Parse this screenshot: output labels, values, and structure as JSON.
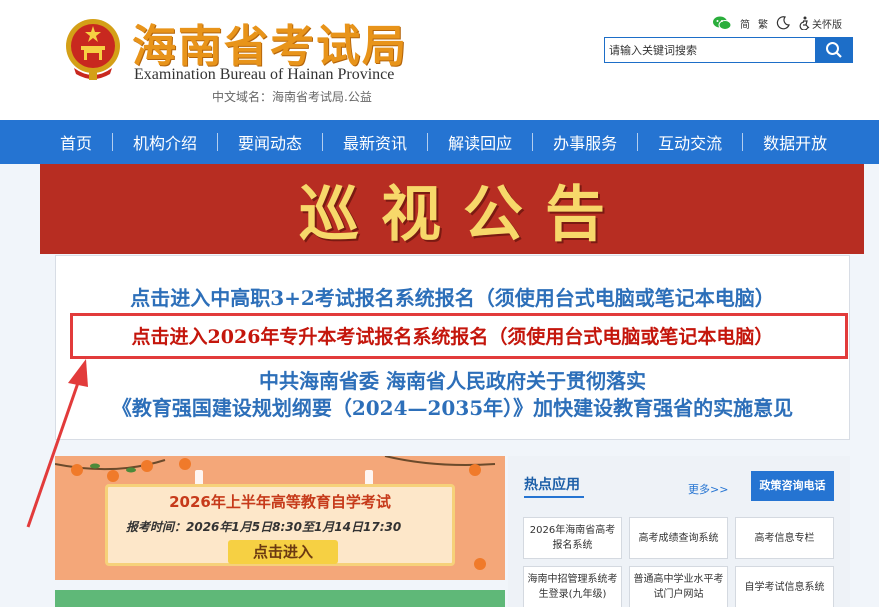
{
  "header": {
    "site_title": "海南省考试局",
    "site_subtitle": "Examination Bureau of Hainan Province",
    "domain_line": "中文域名：海南省考试局.公益",
    "utils": {
      "simplified": "简",
      "traditional": "繁",
      "care": "关怀版"
    },
    "search": {
      "placeholder": "请输入关键词搜索"
    }
  },
  "nav": {
    "items": [
      "首页",
      "机构介绍",
      "要闻动态",
      "最新资讯",
      "解读回应",
      "办事服务",
      "互动交流",
      "数据开放"
    ]
  },
  "banner": {
    "text": "巡视公告"
  },
  "notices": {
    "line1": "点击进入中高职3+2考试报名系统报名（须使用台式电脑或笔记本电脑）",
    "line2": "点击进入2026年专升本考试报名系统报名（须使用台式电脑或笔记本电脑）",
    "line3": "中共海南省委 海南省人民政府关于贯彻落实",
    "line4": "《教育强国建设规划纲要（2024—2035年）》加快建设教育强省的实施意见"
  },
  "promo": {
    "title": "2026年上半年高等教育自学考试",
    "date": "报考时间：2026年1月5日8:30至1月14日17:30",
    "cta": "点击进入"
  },
  "hot_apps": {
    "title": "热点应用",
    "more": "更多>>",
    "phone_button": "政策咨询电话",
    "tiles": [
      "2026年海南省高考报名系统",
      "高考成绩查询系统",
      "高考信息专栏",
      "海南中招管理系统考生登录(九年级)",
      "普通高中学业水平考试门户网站",
      "自学考试信息系统"
    ]
  },
  "colors": {
    "nav_blue": "#2574d2",
    "banner_red": "#b72d22",
    "banner_gold": "#f7d86a",
    "title_orange": "#e8941a",
    "link_blue": "#2d6fb9",
    "highlight_red": "#c4160c",
    "annotation_red": "#e23b3b"
  }
}
